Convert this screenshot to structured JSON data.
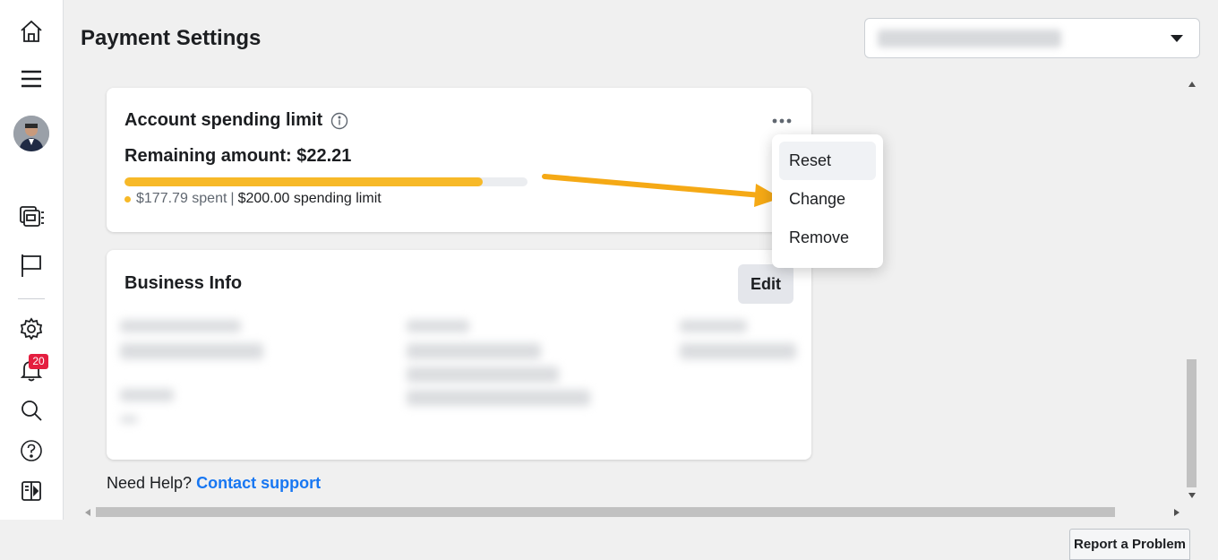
{
  "page": {
    "title": "Payment Settings"
  },
  "account_selector": {
    "value_blurred": true
  },
  "nav": {
    "notification_count": "20"
  },
  "spending_limit": {
    "title": "Account spending limit",
    "remaining": "Remaining amount: $22.21",
    "spent": "$177.79 spent",
    "separator": "|",
    "limit": "$200.00 spending limit",
    "progress_fraction": 0.889
  },
  "menu": {
    "items": [
      "Reset",
      "Change",
      "Remove"
    ],
    "hovered": "Reset"
  },
  "business_info": {
    "title": "Business Info",
    "edit_label": "Edit"
  },
  "help": {
    "prefix": "Need Help?",
    "link": "Contact support"
  },
  "report": {
    "label": "Report a Problem"
  },
  "colors": {
    "accent": "#f7b928",
    "link": "#1877f2",
    "badge": "#e41e3f",
    "annotation_arrow": "#f5a915"
  }
}
